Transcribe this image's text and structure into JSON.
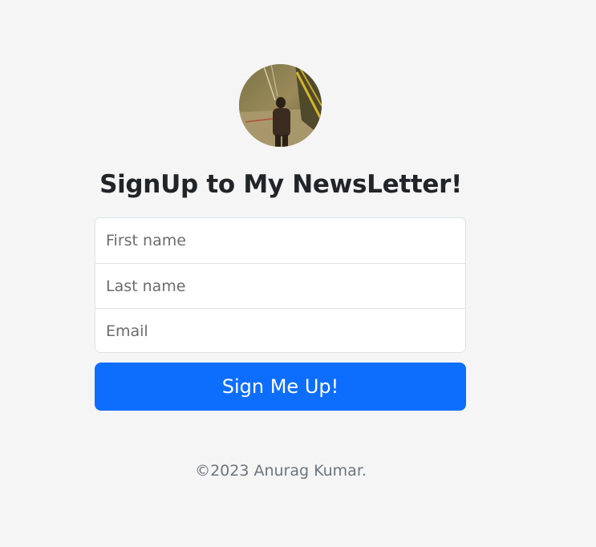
{
  "avatar": {
    "alt": "profile photo"
  },
  "header": {
    "title": "SignUp to My NewsLetter!"
  },
  "form": {
    "first_name": {
      "placeholder": "First name",
      "value": ""
    },
    "last_name": {
      "placeholder": "Last name",
      "value": ""
    },
    "email": {
      "placeholder": "Email",
      "value": ""
    },
    "submit_label": "Sign Me Up!"
  },
  "footer": {
    "copyright": "©2023 Anurag Kumar."
  },
  "colors": {
    "background": "#f5f5f5",
    "primary": "#0d6efd",
    "border": "#dee2e6",
    "muted": "#6c757d"
  }
}
